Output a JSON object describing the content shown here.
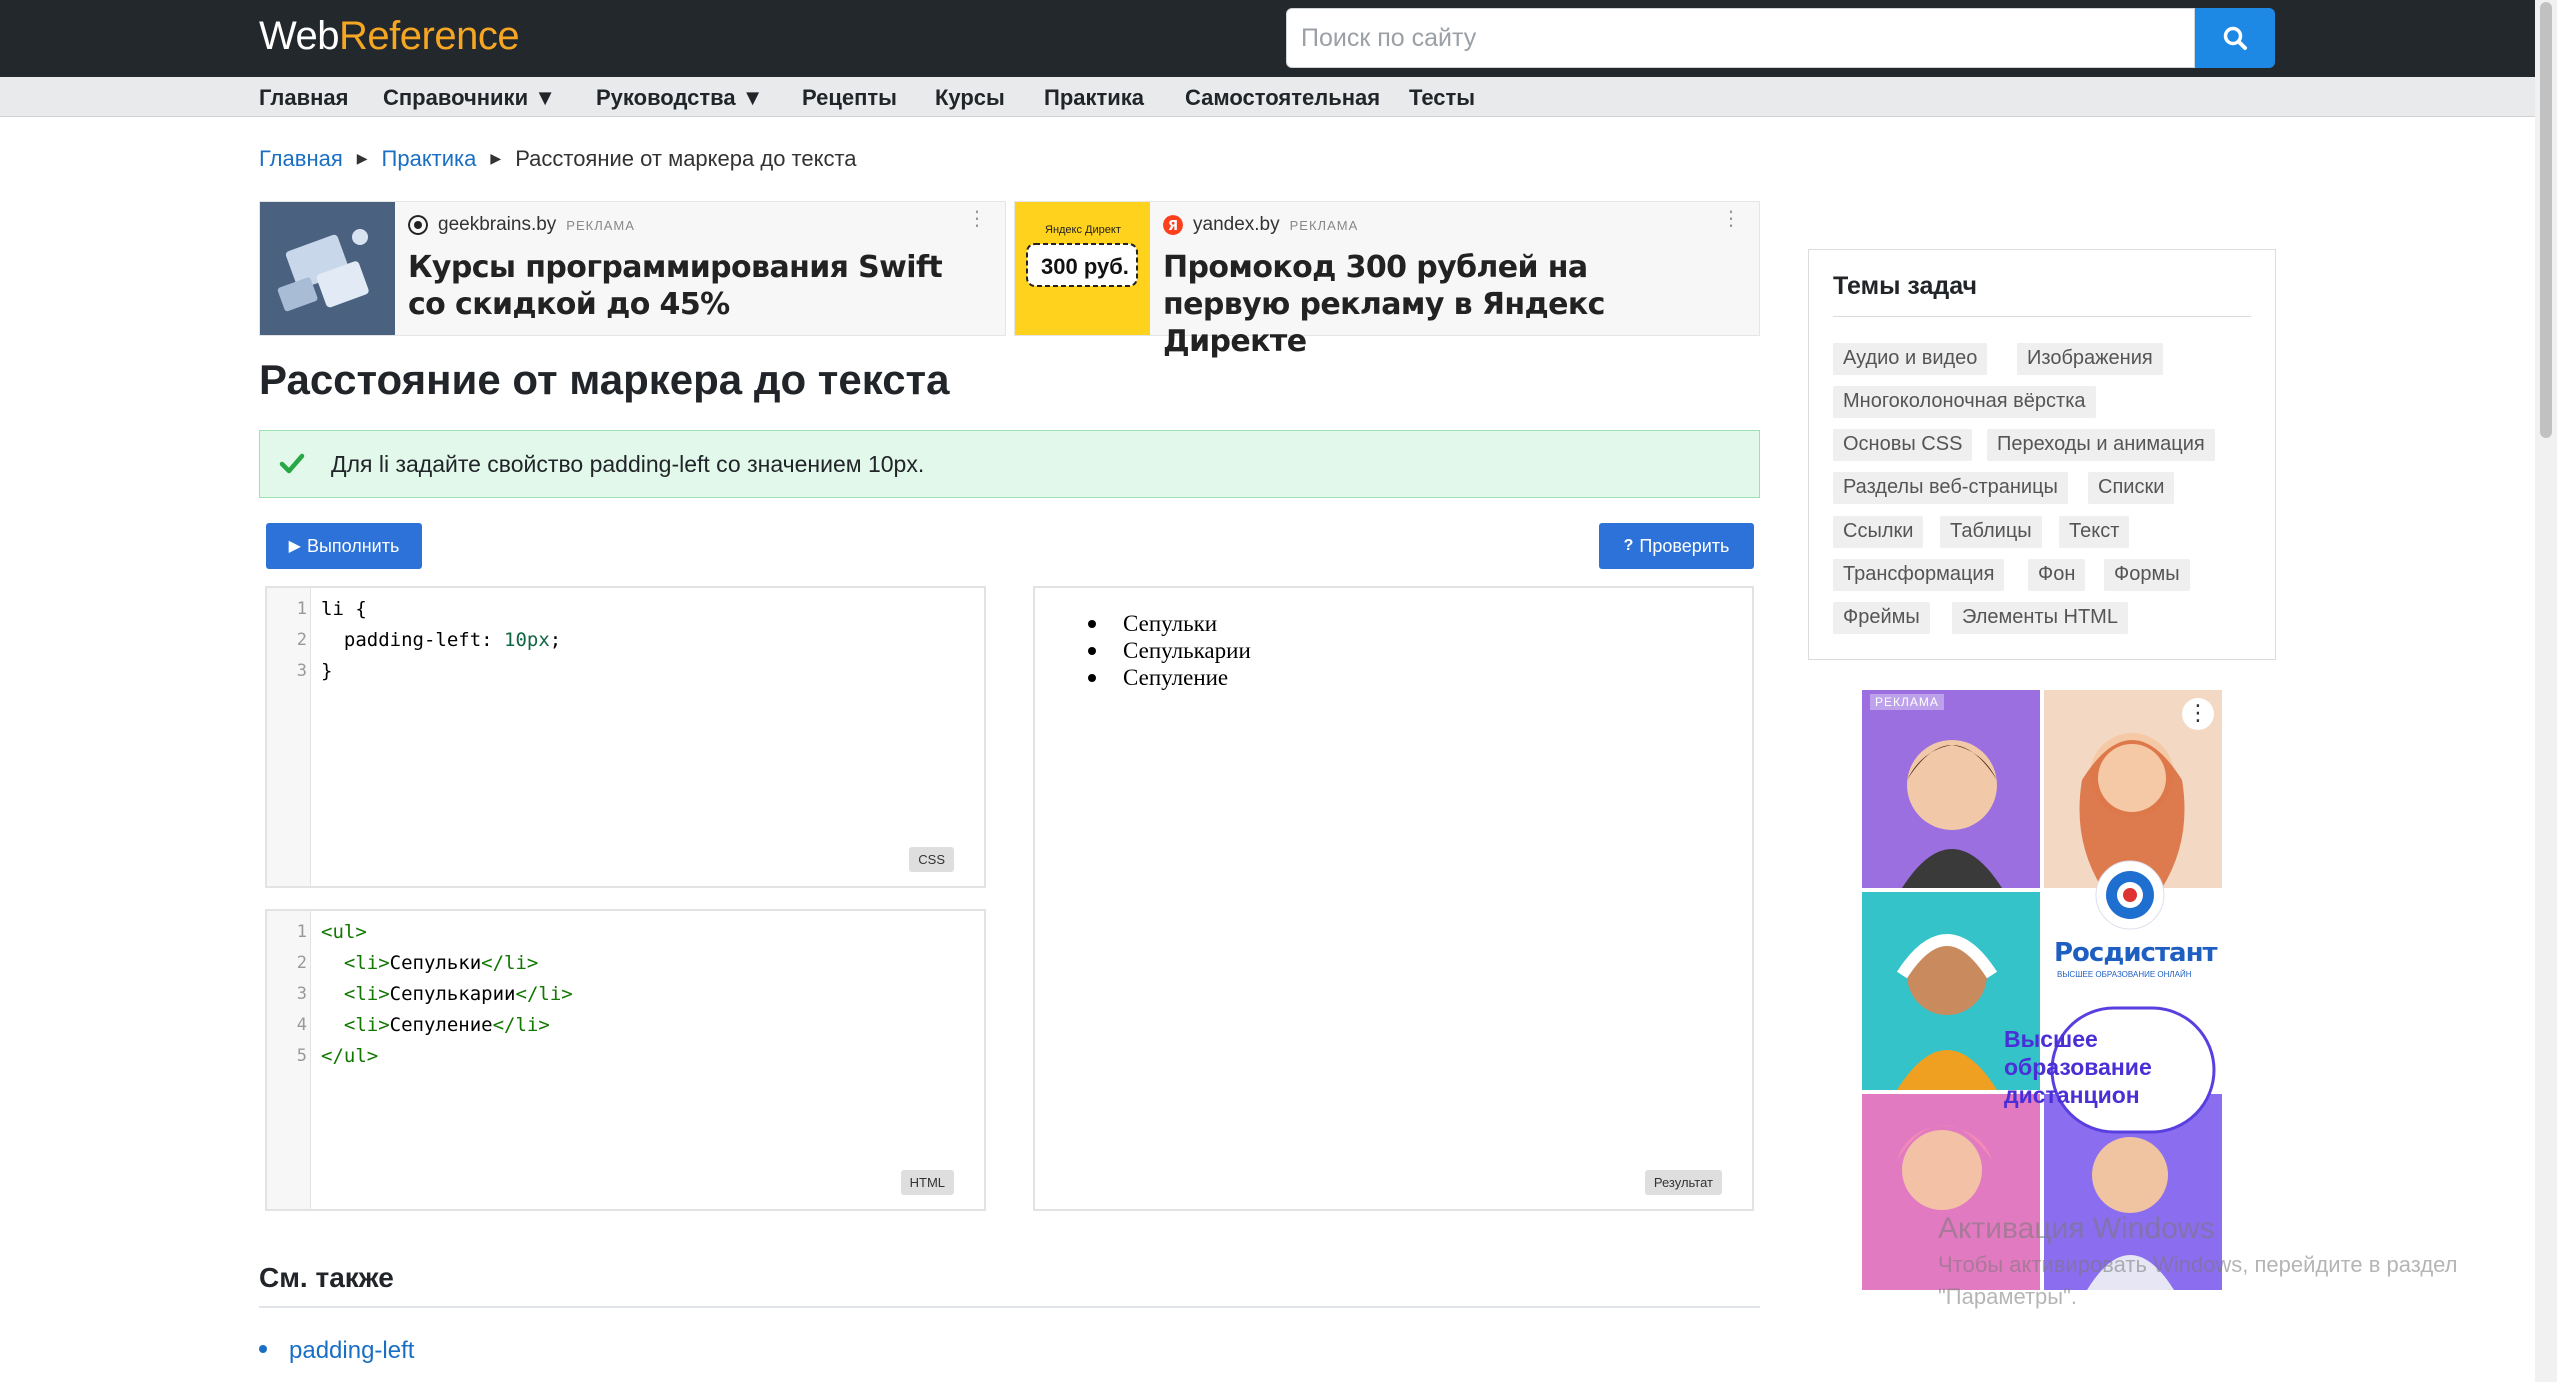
{
  "header": {
    "logo_part1": "Web",
    "logo_part2": "Reference",
    "search_placeholder": "Поиск по сайту"
  },
  "nav": {
    "items": [
      "Главная",
      "Справочники ▼",
      "Руководства ▼",
      "Рецепты",
      "Курсы",
      "Практика",
      "Самостоятельная",
      "Тесты"
    ]
  },
  "breadcrumb": {
    "home": "Главная",
    "section": "Практика",
    "current": "Расстояние от маркера до текста"
  },
  "ads": [
    {
      "source": "geekbrains.by",
      "tag": "РЕКЛАМА",
      "title": "Курсы программирования Swift со скидкой до 45%"
    },
    {
      "source": "yandex.by",
      "tag": "РЕКЛАМА",
      "title": "Промокод 300 рублей на первую рекламу в Яндекс Директе",
      "image_top": "Яндекс Директ",
      "image_badge": "300 руб."
    }
  ],
  "page": {
    "title": "Расстояние от маркера до текста",
    "task": "Для li задайте свойство padding-left со значением 10px.",
    "run_button": "Выполнить",
    "check_button": "Проверить"
  },
  "css_editor": {
    "label": "CSS",
    "lines": [
      "li {",
      "  padding-left: ",
      "10px",
      ";",
      "}"
    ]
  },
  "html_editor": {
    "label": "HTML",
    "lines": [
      "<ul>",
      "<li>",
      "Сепульки",
      "</li>",
      "<li>",
      "Сепулькарии",
      "</li>",
      "<li>",
      "Сепуление",
      "</li>",
      "</ul>"
    ]
  },
  "result": {
    "label": "Результат",
    "items": [
      "Сепульки",
      "Сепулькарии",
      "Сепуление"
    ]
  },
  "see_also": {
    "title": "См. также",
    "items": [
      "padding-left"
    ]
  },
  "sidebar": {
    "topics_title": "Темы задач",
    "topics": [
      "Аудио и видео",
      "Изображения",
      "Многоколоночная вёрстка",
      "Основы CSS",
      "Переходы и анимация",
      "Разделы веб-страницы",
      "Списки",
      "Ссылки",
      "Таблицы",
      "Текст",
      "Трансформация",
      "Фон",
      "Формы",
      "Фреймы",
      "Элементы HTML"
    ],
    "ad": {
      "tag": "РЕКЛАМА",
      "brand": "Росдистант",
      "brand_sub": "ВЫСШЕЕ ОБРАЗОВАНИЕ ОНЛАЙН",
      "headline": "Высшее образование дистанцион"
    }
  },
  "overlay": {
    "activation_title": "Активация Windows",
    "activation_line1": "Чтобы активировать Windows, перейдите в раздел",
    "activation_line2": "\"Параметры\"."
  },
  "colors": {
    "header_bg": "#23282d",
    "accent": "#f5a623",
    "link": "#1a6fc4",
    "button": "#2d72d9",
    "search_button": "#1e88e5",
    "success_bg": "#e2f8ea"
  }
}
